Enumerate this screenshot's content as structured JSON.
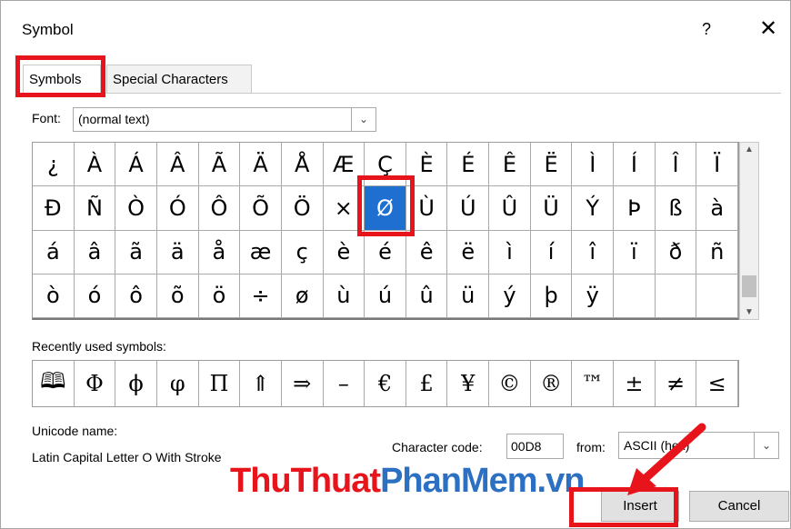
{
  "dialog": {
    "title": "Symbol",
    "help_label": "?",
    "close_label": "✕"
  },
  "tabs": {
    "symbols": "Symbols",
    "special_characters": "Special Characters"
  },
  "font": {
    "label": "Font:",
    "value": "(normal text)"
  },
  "symbol_grid": [
    [
      "¿",
      "À",
      "Á",
      "Â",
      "Ã",
      "Ä",
      "Å",
      "Æ",
      "Ç",
      "È",
      "É",
      "Ê",
      "Ë",
      "Ì",
      "Í",
      "Î",
      "Ï"
    ],
    [
      "Ð",
      "Ñ",
      "Ò",
      "Ó",
      "Ô",
      "Õ",
      "Ö",
      "×",
      "Ø",
      "Ù",
      "Ú",
      "Û",
      "Ü",
      "Ý",
      "Þ",
      "ß",
      "à"
    ],
    [
      "á",
      "â",
      "ã",
      "ä",
      "å",
      "æ",
      "ç",
      "è",
      "é",
      "ê",
      "ë",
      "ì",
      "í",
      "î",
      "ï",
      "ð",
      "ñ"
    ],
    [
      "ò",
      "ó",
      "ô",
      "õ",
      "ö",
      "÷",
      "ø",
      "ù",
      "ú",
      "û",
      "ü",
      "ý",
      "þ",
      "ÿ",
      "",
      "",
      ""
    ]
  ],
  "selected_symbol": "Ø",
  "recent": {
    "label": "Recently used symbols:",
    "items": [
      "🕮",
      "Φ",
      "ϕ",
      "φ",
      "Π",
      "⇑",
      "⇒",
      "–",
      "€",
      "£",
      "¥",
      "©",
      "®",
      "™",
      "±",
      "≠",
      "≤"
    ]
  },
  "unicode": {
    "label": "Unicode name:",
    "value": "Latin Capital Letter O With Stroke"
  },
  "character_code": {
    "label": "Character code:",
    "value": "00D8"
  },
  "from": {
    "label": "from:",
    "value": "ASCII (hex)"
  },
  "watermark": {
    "part1": "ThuThuat",
    "part2": "PhanMem.vn"
  },
  "buttons": {
    "insert": "Insert",
    "cancel": "Cancel"
  },
  "colors": {
    "highlight_red": "#e8141b",
    "selection_blue": "#1f6fd1"
  }
}
